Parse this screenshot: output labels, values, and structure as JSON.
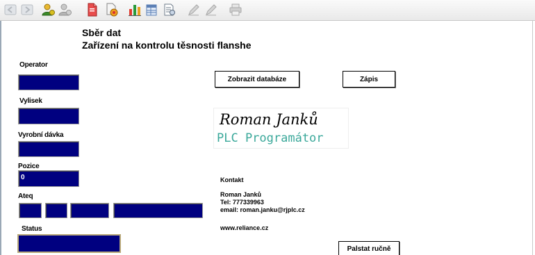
{
  "toolbar": {
    "buttons": [
      {
        "icon": "arrow-left-icon",
        "enabled": false
      },
      {
        "icon": "arrow-right-icon",
        "enabled": false
      },
      {
        "icon": "user-icon",
        "enabled": true
      },
      {
        "icon": "user-gray-icon",
        "enabled": false
      },
      {
        "icon": "document-red-icon",
        "enabled": true
      },
      {
        "icon": "document-settings-icon",
        "enabled": true
      },
      {
        "icon": "bar-chart-icon",
        "enabled": true
      },
      {
        "icon": "database-table-icon",
        "enabled": true
      },
      {
        "icon": "report-icon",
        "enabled": true
      },
      {
        "icon": "edit-icon",
        "enabled": false
      },
      {
        "icon": "edit-alt-icon",
        "enabled": false
      },
      {
        "icon": "print-icon",
        "enabled": false
      }
    ]
  },
  "header": {
    "title_line1": "Sběr dat",
    "title_line2": "Zařízení na kontrolu těsnosti flanshe"
  },
  "form": {
    "operator_label": "Operator",
    "operator_value": "",
    "vylisek_label": "Vylisek",
    "vylisek_value": "",
    "batch_label": "Vyrobní dávka",
    "batch_value": "",
    "pozice_label": "Pozice",
    "pozice_value": "0",
    "ateq_label": "Ateq",
    "ateq_values": [
      "",
      "",
      "",
      ""
    ],
    "status_label": "Status",
    "status_value": ""
  },
  "buttons": {
    "show_db": "Zobrazit databáze",
    "write": "Zápis",
    "manual": "Palstat ručně"
  },
  "logo": {
    "name": "Roman Janků",
    "role": "PLC Programátor"
  },
  "contact": {
    "heading": "Kontakt",
    "name": "Roman Janků",
    "tel": "Tel: 777339963",
    "email": "email: roman.janku@rjplc.cz",
    "web": "www.reliance.cz"
  },
  "colors": {
    "field_background": "#000080",
    "role_text": "#3aa89a",
    "status_border": "#b8a87a"
  }
}
